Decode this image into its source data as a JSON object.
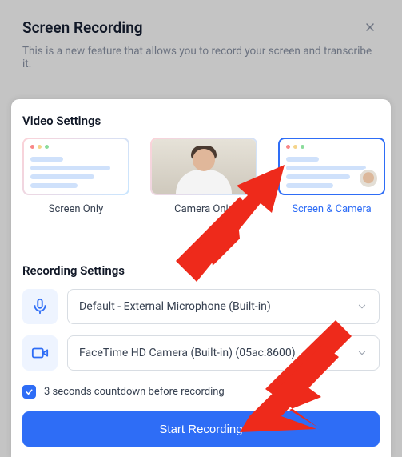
{
  "header": {
    "title": "Screen Recording",
    "subtitle": "This is a new feature that allows you to record your screen and transcribe it."
  },
  "videoSettings": {
    "title": "Video Settings",
    "options": {
      "screenOnly": "Screen Only",
      "cameraOnly": "Camera Only",
      "screenAndCamera": "Screen & Camera"
    }
  },
  "recordingSettings": {
    "title": "Recording Settings",
    "micValue": "Default - External Microphone (Built-in)",
    "cameraValue": "FaceTime HD Camera (Built-in) (05ac:8600)"
  },
  "countdown": {
    "label": "3 seconds countdown before recording",
    "checked": true
  },
  "startButton": "Start Recording",
  "colors": {
    "accent": "#2e6df6"
  }
}
